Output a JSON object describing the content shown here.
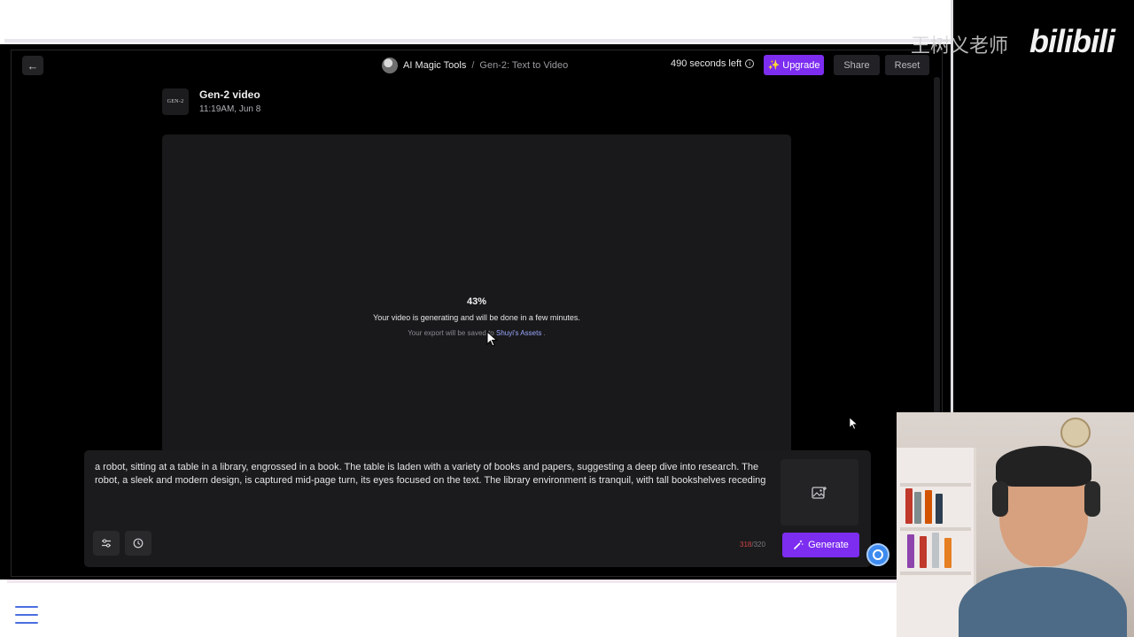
{
  "header": {
    "back_icon": "arrow-left-icon",
    "breadcrumb_root": "AI Magic Tools",
    "breadcrumb_sep": "/",
    "breadcrumb_page": "Gen-2: Text to Video",
    "seconds_left": "490 seconds left",
    "upgrade_label": "Upgrade",
    "share_label": "Share",
    "reset_label": "Reset"
  },
  "video": {
    "logo_text": "GEN-2",
    "title": "Gen-2 video",
    "timestamp": "11:19AM, Jun 8",
    "progress": "43%",
    "generating_message": "Your video is generating and will be done in a few minutes.",
    "export_prefix": "Your export will be saved to",
    "export_link": "Shuyi's Assets",
    "export_suffix": "."
  },
  "prompt": {
    "text": "a robot, sitting at a table in a library, engrossed in a book. The table is laden with a variety of books and papers, suggesting a deep dive into research. The robot, a sleek and modern design, is captured mid-page turn, its eyes focused on the text. The library environment is tranquil, with tall bookshelves receding",
    "char_count": "318",
    "char_max": "/320",
    "generate_label": "Generate"
  },
  "watermark": {
    "channel": "王树义老师",
    "logo": "bilibili"
  },
  "colors": {
    "accent": "#7c2df0",
    "background": "#000000",
    "panel": "#1b1b1d",
    "counter_warning": "#d24444"
  }
}
